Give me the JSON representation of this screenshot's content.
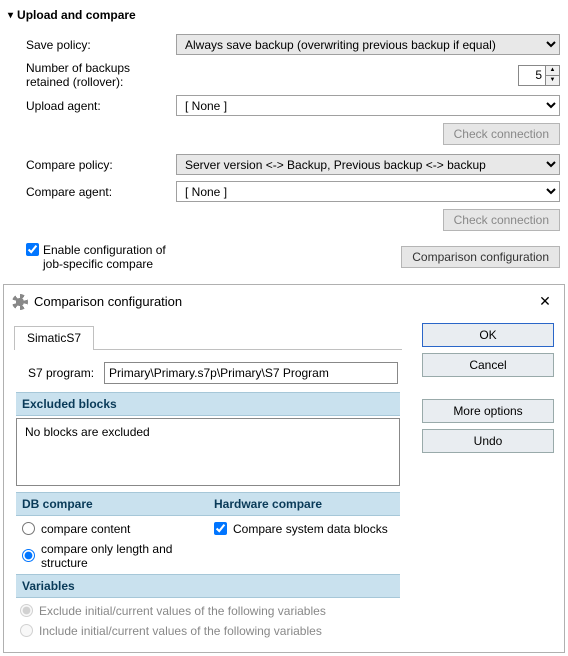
{
  "section_title": "Upload and compare",
  "labels": {
    "save_policy": "Save policy:",
    "backup_count": "Number of backups retained (rollover):",
    "upload_agent": "Upload agent:",
    "compare_policy": "Compare policy:",
    "compare_agent": "Compare agent:",
    "check_conn": "Check connection",
    "enable_cfg": "Enable configuration of job-specific compare",
    "comp_cfg_btn": "Comparison configuration"
  },
  "values": {
    "save_policy": "Always save backup (overwriting previous backup if equal)",
    "backup_count": "5",
    "upload_agent": "[ None ]",
    "compare_policy": "Server version <-> Backup, Previous backup <-> backup",
    "compare_agent": "[ None ]",
    "enable_cfg_checked": true
  },
  "dialog": {
    "title": "Comparison configuration",
    "tab": "SimaticS7",
    "s7_label": "S7 program:",
    "s7_value": "Primary\\Primary.s7p\\Primary\\S7 Program",
    "band_excluded": "Excluded blocks",
    "excluded_text": "No blocks are excluded",
    "band_db": "DB compare",
    "band_hw": "Hardware compare",
    "db_opt1": "compare content",
    "db_opt2": "compare only length and structure",
    "hw_opt": "Compare system data blocks",
    "band_vars": "Variables",
    "var_opt1": "Exclude initial/current values of the following variables",
    "var_opt2": "Include initial/current values of the following variables",
    "buttons": {
      "ok": "OK",
      "cancel": "Cancel",
      "more": "More options",
      "undo": "Undo"
    }
  }
}
